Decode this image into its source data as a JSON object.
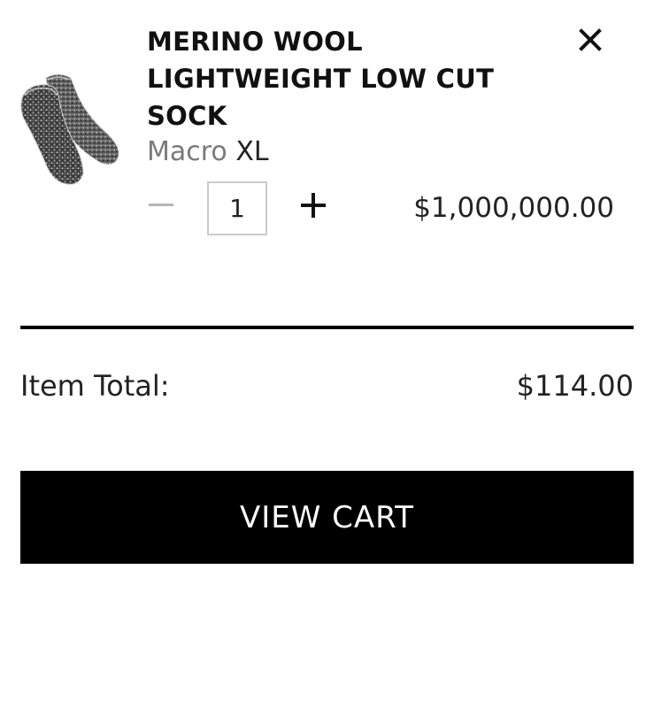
{
  "cart_item": {
    "product_name": "MERINO WOOL LIGHTWEIGHT LOW CUT SOCK",
    "color": "Macro",
    "size": "XL",
    "quantity": "1",
    "price": "$1,000,000.00",
    "remove_icon": "close-icon",
    "decrease_icon": "minus-icon",
    "increase_icon": "plus-icon",
    "image": "sock-product-image"
  },
  "summary": {
    "item_total_label": "Item Total:",
    "item_total_value": "$114.00"
  },
  "actions": {
    "view_cart_label": "VIEW CART"
  },
  "colors": {
    "primary": "#000000",
    "button_text": "#ffffff",
    "muted_text": "#7a7a7a",
    "disabled_icon": "#b5b5b5",
    "input_border": "#cccccc"
  }
}
